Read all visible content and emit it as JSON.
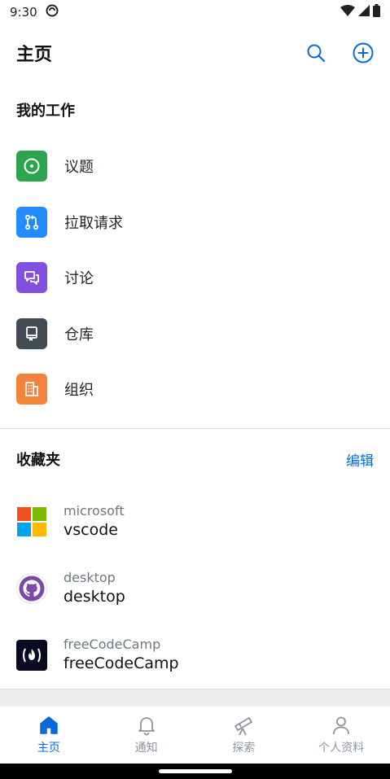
{
  "status_bar": {
    "time": "9:30"
  },
  "app_bar": {
    "title": "主页"
  },
  "my_work": {
    "title": "我的工作",
    "items": [
      {
        "label": "议题",
        "color": "#2da44e",
        "icon": "issue-icon"
      },
      {
        "label": "拉取请求",
        "color": "#218bff",
        "icon": "pull-request-icon"
      },
      {
        "label": "讨论",
        "color": "#8250df",
        "icon": "discussion-icon"
      },
      {
        "label": "仓库",
        "color": "#424a53",
        "icon": "repo-icon"
      },
      {
        "label": "组织",
        "color": "#f3823b",
        "icon": "organization-icon"
      }
    ]
  },
  "favorites": {
    "title": "收藏夹",
    "edit_label": "编辑",
    "items": [
      {
        "owner": "microsoft",
        "repo": "vscode",
        "icon": "microsoft-logo"
      },
      {
        "owner": "desktop",
        "repo": "desktop",
        "icon": "github-desktop-logo"
      },
      {
        "owner": "freeCodeCamp",
        "repo": "freeCodeCamp",
        "icon": "freecodecamp-logo"
      }
    ]
  },
  "bottom_nav": {
    "items": [
      {
        "label": "主页",
        "icon": "home-icon",
        "active": true
      },
      {
        "label": "通知",
        "icon": "bell-icon",
        "active": false
      },
      {
        "label": "探索",
        "icon": "telescope-icon",
        "active": false
      },
      {
        "label": "个人资料",
        "icon": "person-icon",
        "active": false
      }
    ]
  },
  "colors": {
    "accent": "#0969da",
    "inactive": "#8c959f"
  }
}
